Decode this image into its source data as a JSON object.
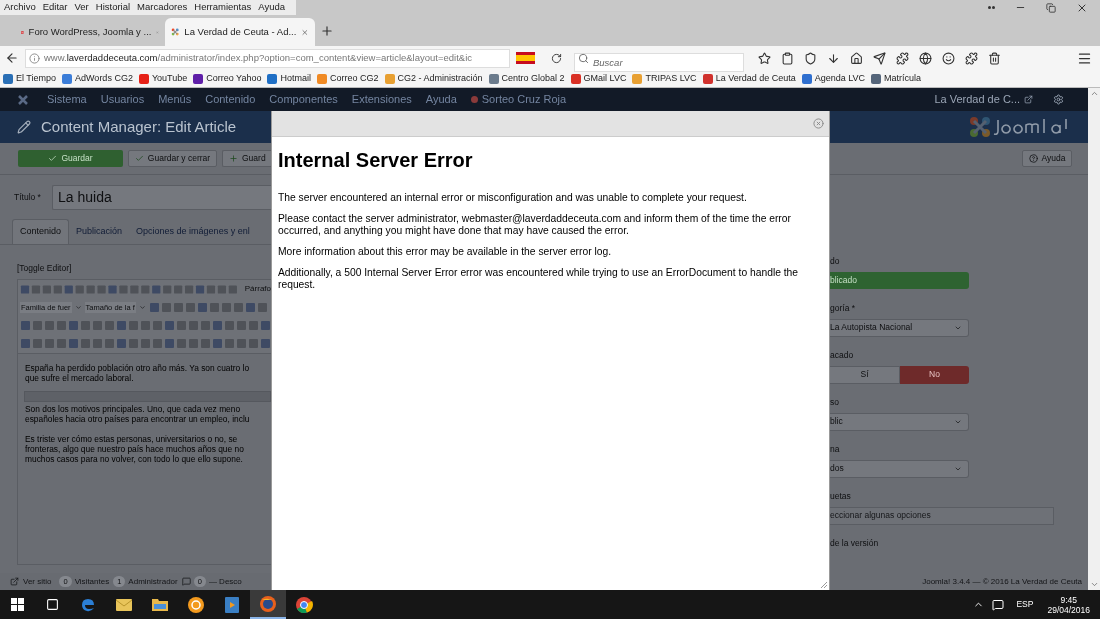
{
  "browser": {
    "menu": [
      "Archivo",
      "Editar",
      "Ver",
      "Historial",
      "Marcadores",
      "Herramientas",
      "Ayuda"
    ],
    "tabs": [
      {
        "title": "Foro WordPress, Joomla y ...",
        "kind": "forum",
        "selected": false
      },
      {
        "title": "La Verdad de Ceuta - Ad...",
        "kind": "joomla",
        "selected": true
      }
    ],
    "url": {
      "prefix": "www.",
      "host": "laverdaddeceuta.com",
      "path": "/administrator/index.php?option=com_content&view=article&layout=edit&ic"
    },
    "search": {
      "placeholder": "Buscar"
    },
    "bookmarks": [
      {
        "label": "El Tiempo",
        "color": "#2a6fb5"
      },
      {
        "label": "AdWords CG2",
        "color": "#3b7dd8"
      },
      {
        "label": "YouTube",
        "color": "#e62117"
      },
      {
        "label": "Correo Yahoo",
        "color": "#5f1fa8"
      },
      {
        "label": "Hotmail",
        "color": "#1f6fc5"
      },
      {
        "label": "Correo CG2",
        "color": "#f08a24"
      },
      {
        "label": "CG2 - Administración",
        "color": "#e8a032"
      },
      {
        "label": "Centro Global 2",
        "color": "#6b7b8c"
      },
      {
        "label": "GMail LVC",
        "color": "#d93025"
      },
      {
        "label": "TRIPAS LVC",
        "color": "#e8a032"
      },
      {
        "label": "La Verdad de Ceuta",
        "color": "#d0312d"
      },
      {
        "label": "Agenda LVC",
        "color": "#2f6fcf"
      },
      {
        "label": "Matrícula",
        "color": "#55657a"
      }
    ]
  },
  "admin": {
    "nav": [
      "Sistema",
      "Usuarios",
      "Menús",
      "Contenido",
      "Componentes",
      "Extensiones",
      "Ayuda"
    ],
    "nav_extra": "Sorteo Cruz Roja",
    "site_link": "La Verdad de C...",
    "page_title": "Content Manager: Edit Article",
    "toolbar": [
      {
        "label": "Guardar",
        "kind": "primary"
      },
      {
        "label": "Guardar y cerrar",
        "kind": "check"
      },
      {
        "label": "Guard",
        "kind": "plus"
      }
    ],
    "help": "Ayuda",
    "title_label": "Título *",
    "title_value": "La huida",
    "tabs": [
      {
        "label": "Contenido",
        "selected": true
      },
      {
        "label": "Publicación",
        "selected": false
      },
      {
        "label": "Opciones de imágenes y enl",
        "selected": false
      }
    ],
    "toggle_editor": "[Toggle Editor]",
    "editor": {
      "format": "Párrafo",
      "font_family": "Familia de fuer",
      "font_size": "Tamaño de la f",
      "paragraphs": [
        [
          "España ha perdido población otro año más. Ya son cuatro lo",
          "que sufre el mercado laboral."
        ],
        [
          "Son dos los motivos principales. Uno, que cada vez meno",
          "españoles hacia otro países para encontrar un empleo, inclu"
        ],
        [
          "Es triste ver cómo estas personas, universitarios o no, se",
          "fronteras, algo que nuestro país hace muchos años que no",
          "muchos casos para no volver, con todo lo que ello supone."
        ]
      ]
    },
    "sidebar": [
      {
        "label": "do",
        "kind": "badge",
        "value": "blicado"
      },
      {
        "label": "goría *",
        "kind": "select",
        "value": "La Autopista Nacional"
      },
      {
        "label": "acado",
        "kind": "toggle",
        "options": [
          {
            "label": "Sí",
            "selected": false
          },
          {
            "label": "No",
            "selected": true
          }
        ]
      },
      {
        "label": "so",
        "kind": "select",
        "value": "blic"
      },
      {
        "label": "na",
        "kind": "select",
        "value": "dos"
      },
      {
        "label": "uetas",
        "kind": "tags",
        "placeholder": "eccionar algunas opciones"
      },
      {
        "label": "de la versión",
        "kind": "label"
      }
    ],
    "footer": {
      "view_site": "Ver sitio",
      "counters": [
        {
          "count": "0",
          "label": "Visitantes",
          "kind": "users"
        },
        {
          "count": "1",
          "label": "Administrador",
          "kind": "users"
        },
        {
          "count": "0",
          "label": "— Desco",
          "kind": "messages"
        }
      ],
      "copyright": "Joomla! 3.4.4 — © 2016 La Verdad de Ceuta"
    }
  },
  "dialog": {
    "title": "Internal Server Error",
    "paragraphs": [
      "The server encountered an internal error or misconfiguration and was unable to complete your request.",
      "Please contact the server administrator, webmaster@laverdaddeceuta.com and inform them of the time the error occurred, and anything you might have done that may have caused the error.",
      "More information about this error may be available in the server error log.",
      "Additionally, a 500 Internal Server Error error was encountered while trying to use an ErrorDocument to handle the request."
    ]
  },
  "taskbar": {
    "apps": [
      {
        "kind": "edge",
        "selected": false
      },
      {
        "kind": "mail",
        "selected": false
      },
      {
        "kind": "folder",
        "selected": false
      },
      {
        "kind": "orange",
        "selected": false
      },
      {
        "kind": "media",
        "selected": false
      },
      {
        "kind": "firefox",
        "selected": true
      },
      {
        "kind": "chrome",
        "selected": false
      }
    ],
    "language": "ESP",
    "time": "9:45",
    "date": "29/04/2016"
  }
}
